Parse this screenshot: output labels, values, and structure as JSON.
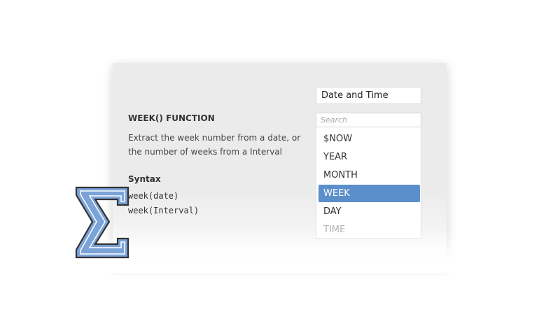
{
  "category": {
    "selected": "Date and Time"
  },
  "search": {
    "placeholder": "Search"
  },
  "options": [
    {
      "label": "$NOW",
      "state": "normal"
    },
    {
      "label": "YEAR",
      "state": "normal"
    },
    {
      "label": "MONTH",
      "state": "normal"
    },
    {
      "label": "WEEK",
      "state": "selected"
    },
    {
      "label": "DAY",
      "state": "normal"
    },
    {
      "label": "TIME",
      "state": "faded"
    }
  ],
  "doc": {
    "title": "WEEK() FUNCTION",
    "description": "Extract the week number from a date, or the number of weeks from a Interval",
    "syntax_label": "Syntax",
    "syntax_lines": [
      "week(date)",
      "week(Interval)"
    ]
  },
  "colors": {
    "accent": "#5b8fcb",
    "logo_fill": "#7ba3d8",
    "logo_outline": "#333333"
  },
  "logo": {
    "icon": "sigma-icon"
  }
}
